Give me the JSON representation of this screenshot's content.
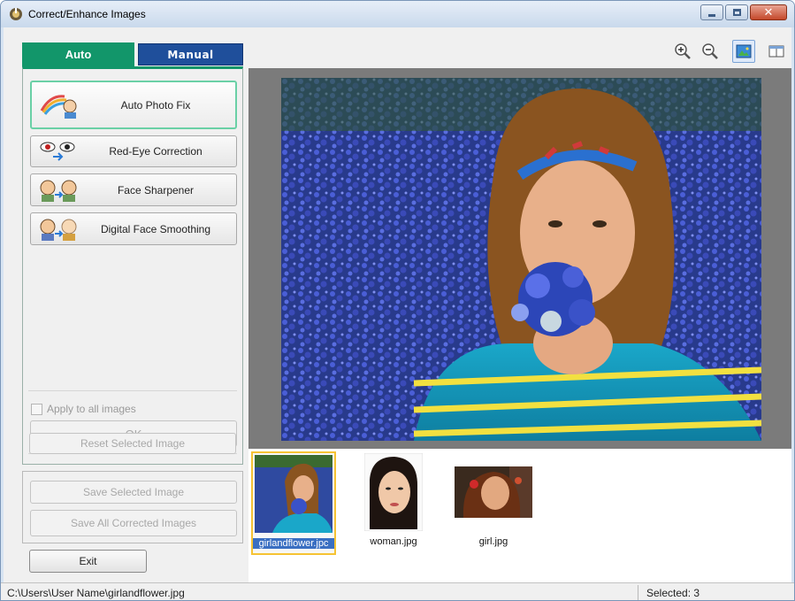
{
  "window": {
    "title": "Correct/Enhance Images",
    "icon": "app-icon",
    "buttons": [
      "minimize",
      "maximize",
      "close"
    ]
  },
  "tabs": {
    "auto": "Auto",
    "manual": "Manual"
  },
  "auto_panel": {
    "fixes": [
      {
        "label": "Auto Photo Fix",
        "icon": "auto-photo-fix-icon",
        "selected": true
      },
      {
        "label": "Red-Eye Correction",
        "icon": "red-eye-icon",
        "selected": false
      },
      {
        "label": "Face Sharpener",
        "icon": "face-sharpener-icon",
        "selected": false
      },
      {
        "label": "Digital Face Smoothing",
        "icon": "face-smoothing-icon",
        "selected": false
      }
    ],
    "apply_all_label": "Apply to all images",
    "ok_label": "OK",
    "reset_label": "Reset Selected Image"
  },
  "save_panel": {
    "save_selected_label": "Save Selected Image",
    "save_all_label": "Save All Corrected Images"
  },
  "exit_label": "Exit",
  "toolbar": {
    "tools": [
      "zoom-in-icon",
      "zoom-out-icon",
      "whole-image-icon",
      "compare-icon"
    ],
    "active_tool": "whole-image-icon"
  },
  "thumbnails": [
    {
      "name": "girlandflower.jpc",
      "selected": true
    },
    {
      "name": "woman.jpg",
      "selected": false
    },
    {
      "name": "girl.jpg",
      "selected": false
    }
  ],
  "status": {
    "path": "C:\\Users\\User Name\\girlandflower.jpg",
    "selected": "Selected: 3"
  }
}
